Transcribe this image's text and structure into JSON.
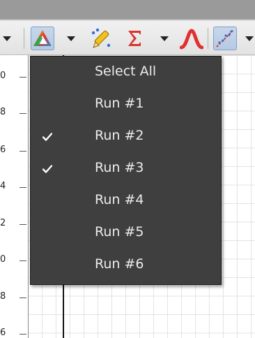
{
  "toolbar": {
    "buttons": [
      {
        "icon": "chevron-down-icon"
      },
      {
        "icon": "triangle-color-icon"
      },
      {
        "icon": "chevron-down-icon"
      },
      {
        "icon": "pencil-icon"
      },
      {
        "icon": "sigma-icon"
      },
      {
        "icon": "chevron-down-icon"
      },
      {
        "icon": "peak-curve-icon"
      },
      {
        "icon": "scatter-fit-icon"
      },
      {
        "icon": "chevron-down-icon"
      }
    ],
    "accent_colors": {
      "sigma": "#d8342c",
      "peak": "#e03030",
      "pressed": "#b6cae3"
    }
  },
  "plot": {
    "y_ticks": [
      "0",
      "8",
      "6",
      "4",
      "2",
      "0",
      "8",
      "6"
    ]
  },
  "menu": {
    "items": [
      {
        "label": "Select All",
        "checked": false
      },
      {
        "label": "Run #1",
        "checked": false
      },
      {
        "label": "Run #2",
        "checked": true
      },
      {
        "label": "Run #3",
        "checked": true
      },
      {
        "label": "Run #4",
        "checked": false
      },
      {
        "label": "Run #5",
        "checked": false
      },
      {
        "label": "Run #6",
        "checked": false
      }
    ]
  }
}
